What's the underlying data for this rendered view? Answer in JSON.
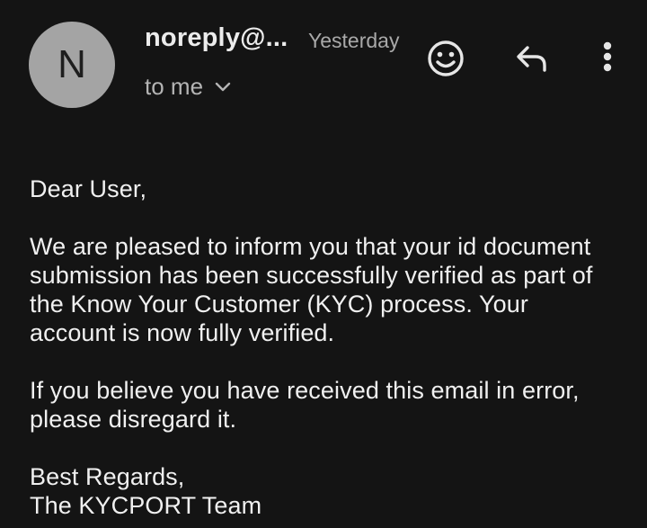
{
  "email": {
    "avatar_letter": "N",
    "sender": "noreply@...",
    "time": "Yesterday",
    "recipient_label": "to me",
    "greeting": "Dear User,",
    "paragraph1": "We are pleased to inform you that your id document\nsubmission has been successfully verified as part of\nthe Know Your Customer (KYC) process. Your\naccount is now fully verified.",
    "paragraph2": "If you believe you have received this email in error,\nplease disregard it.",
    "signoff": "Best Regards,\nThe KYCPORT Team"
  },
  "actions": {
    "emoji_icon": "smiley-face-icon",
    "reply_icon": "reply-arrow-icon",
    "more_icon": "vertical-dots-icon"
  },
  "colors": {
    "background": "#141414",
    "avatar": "#a4a4a4",
    "text": "#f0f0f0",
    "secondary_text": "#a9a9a9"
  }
}
